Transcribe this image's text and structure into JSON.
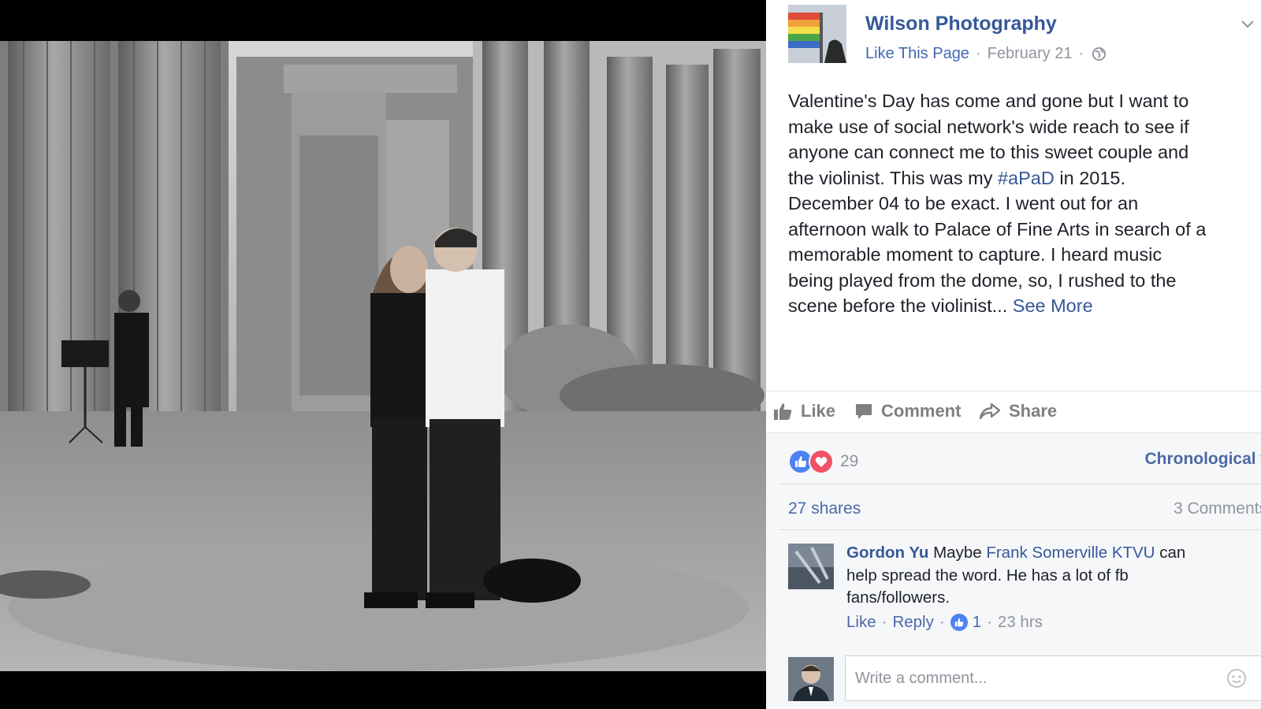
{
  "post": {
    "page_name": "Wilson Photography",
    "like_page": "Like This Page",
    "date": "February 21",
    "separator": "·",
    "text_lines": [
      "Valentine's Day has come and gone but I want to",
      "make use of social network's wide reach to see if",
      "anyone can connect me to this sweet couple and",
      "the violinist. This was my ",
      "December 04 to be exact. I went out for an",
      "afternoon walk to Palace of Fine Arts in search of a",
      "memorable moment to capture. I heard music",
      "being played from the dome, so, I rushed to the",
      "scene before the violinist... "
    ],
    "hashtag": "#aPaD",
    "line4_tail": " in 2015.",
    "see_more": "See More"
  },
  "actions": {
    "like": "Like",
    "comment": "Comment",
    "share": "Share"
  },
  "stats": {
    "reaction_count": "29",
    "sort_label": "Chronological ▾",
    "shares": "27 shares",
    "comments": "3 Comments"
  },
  "comment": {
    "author": "Gordon Yu",
    "text_before": " Maybe ",
    "mention": "Frank Somerville KTVU",
    "text_after": " can",
    "line2": "help spread the word. He has a lot of fb",
    "line3": "fans/followers.",
    "like": "Like",
    "reply": "Reply",
    "like_count": "1",
    "time": "23 hrs"
  },
  "composer": {
    "placeholder": "Write a comment..."
  },
  "colors": {
    "link": "#365899",
    "like_blue": "#4d82f3",
    "love_red": "#f25268"
  },
  "icons": [
    "globe-icon",
    "chevron-down-icon",
    "thumbs-up-icon",
    "comment-icon",
    "share-icon",
    "like-reaction-icon",
    "love-reaction-icon",
    "emoji-icon"
  ]
}
